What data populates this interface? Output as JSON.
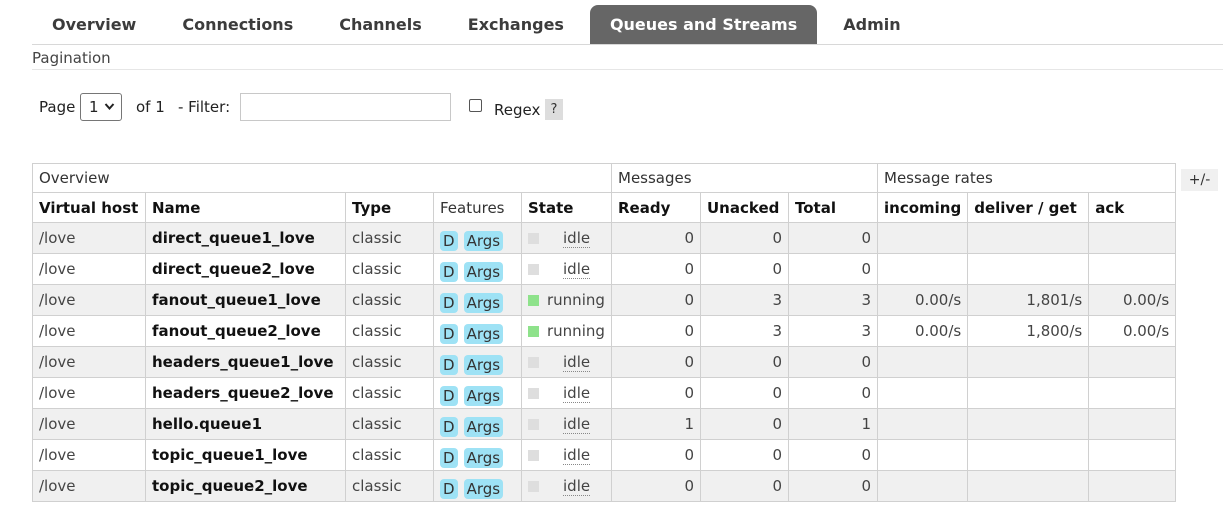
{
  "tabs": [
    {
      "label": "Overview",
      "active": false
    },
    {
      "label": "Connections",
      "active": false
    },
    {
      "label": "Channels",
      "active": false
    },
    {
      "label": "Exchanges",
      "active": false
    },
    {
      "label": "Queues and Streams",
      "active": true
    },
    {
      "label": "Admin",
      "active": false
    }
  ],
  "pagination": {
    "title": "Pagination",
    "page_label": "Page",
    "page_value": "1",
    "of_label": "of 1",
    "filter_label": "- Filter:",
    "filter_value": "",
    "regex_label": "Regex",
    "regex_checked": false,
    "help_label": "?"
  },
  "table": {
    "groups": [
      "Overview",
      "Messages",
      "Message rates"
    ],
    "plus_minus": "+/-",
    "headers": {
      "vhost": "Virtual host",
      "name": "Name",
      "type": "Type",
      "features": "Features",
      "state": "State",
      "ready": "Ready",
      "unacked": "Unacked",
      "total": "Total",
      "incoming": "incoming",
      "deliver_get": "deliver / get",
      "ack": "ack"
    },
    "feature_labels": {
      "d": "D",
      "args": "Args"
    },
    "rows": [
      {
        "vhost": "/love",
        "name": "direct_queue1_love",
        "type": "classic",
        "state": "idle",
        "ready": "0",
        "unacked": "0",
        "total": "0",
        "incoming": "",
        "deliver_get": "",
        "ack": ""
      },
      {
        "vhost": "/love",
        "name": "direct_queue2_love",
        "type": "classic",
        "state": "idle",
        "ready": "0",
        "unacked": "0",
        "total": "0",
        "incoming": "",
        "deliver_get": "",
        "ack": ""
      },
      {
        "vhost": "/love",
        "name": "fanout_queue1_love",
        "type": "classic",
        "state": "running",
        "ready": "0",
        "unacked": "3",
        "total": "3",
        "incoming": "0.00/s",
        "deliver_get": "1,801/s",
        "ack": "0.00/s"
      },
      {
        "vhost": "/love",
        "name": "fanout_queue2_love",
        "type": "classic",
        "state": "running",
        "ready": "0",
        "unacked": "3",
        "total": "3",
        "incoming": "0.00/s",
        "deliver_get": "1,800/s",
        "ack": "0.00/s"
      },
      {
        "vhost": "/love",
        "name": "headers_queue1_love",
        "type": "classic",
        "state": "idle",
        "ready": "0",
        "unacked": "0",
        "total": "0",
        "incoming": "",
        "deliver_get": "",
        "ack": ""
      },
      {
        "vhost": "/love",
        "name": "headers_queue2_love",
        "type": "classic",
        "state": "idle",
        "ready": "0",
        "unacked": "0",
        "total": "0",
        "incoming": "",
        "deliver_get": "",
        "ack": ""
      },
      {
        "vhost": "/love",
        "name": "hello.queue1",
        "type": "classic",
        "state": "idle",
        "ready": "1",
        "unacked": "0",
        "total": "1",
        "incoming": "",
        "deliver_get": "",
        "ack": ""
      },
      {
        "vhost": "/love",
        "name": "topic_queue1_love",
        "type": "classic",
        "state": "idle",
        "ready": "0",
        "unacked": "0",
        "total": "0",
        "incoming": "",
        "deliver_get": "",
        "ack": ""
      },
      {
        "vhost": "/love",
        "name": "topic_queue2_love",
        "type": "classic",
        "state": "idle",
        "ready": "0",
        "unacked": "0",
        "total": "0",
        "incoming": "",
        "deliver_get": "",
        "ack": ""
      }
    ]
  }
}
